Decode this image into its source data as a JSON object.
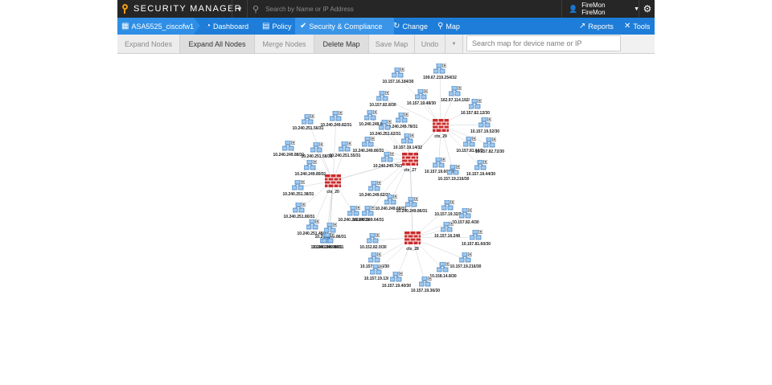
{
  "topbar": {
    "logo_text": "SECURITY MANAGER",
    "search_placeholder": "Search by Name or IP Address",
    "user_name": "FireMon FireMon",
    "icons": {
      "logo": "magnifier-logo-icon",
      "menu_caret": "caret-down-icon",
      "search": "search-icon",
      "user": "user-icon",
      "settings": "gear-icon"
    }
  },
  "nav": {
    "device_name": "ASA5525_ciscofw1",
    "items": [
      {
        "label": "Dashboard",
        "icon": "dashboard-icon"
      },
      {
        "label": "Policy",
        "icon": "document-icon"
      },
      {
        "label": "Security & Compliance",
        "icon": "check-shield-icon"
      },
      {
        "label": "Change",
        "icon": "refresh-icon"
      },
      {
        "label": "Map",
        "icon": "map-marker-icon"
      }
    ],
    "right": [
      {
        "label": "Reports",
        "icon": "line-chart-icon"
      },
      {
        "label": "Tools",
        "icon": "tools-icon"
      }
    ]
  },
  "toolbar": {
    "buttons": [
      {
        "label": "Expand Nodes",
        "enabled": false
      },
      {
        "label": "Expand All Nodes",
        "enabled": true
      },
      {
        "label": "Merge Nodes",
        "enabled": false
      },
      {
        "label": "Delete Map",
        "enabled": true
      },
      {
        "label": "Save Map",
        "enabled": false
      },
      {
        "label": "Undo",
        "enabled": false
      }
    ],
    "search_placeholder": "Search map for device name or IP"
  },
  "colors": {
    "topbar": "#262626",
    "nav": "#1d7dd8",
    "firewall": "#cc2b2b",
    "link": "#c9cfd6",
    "node": "#8fc1ea"
  },
  "map": {
    "firewalls": [
      {
        "id": "f20",
        "label": "ctx_20"
      },
      {
        "id": "f27",
        "label": "ctx_27"
      },
      {
        "id": "f29",
        "label": "ctx_29"
      },
      {
        "id": "f28",
        "label": "ctx_28"
      }
    ],
    "links": [
      [
        "f20",
        "f27"
      ],
      [
        "f27",
        "f29"
      ],
      [
        "f27",
        "f28"
      ]
    ],
    "networks": [
      {
        "label": "10.240.251.56/31",
        "fw": "f20"
      },
      {
        "label": "10.240.249.82/31",
        "fw": "f20"
      },
      {
        "label": "10.240.249.88/31",
        "fw": "f20"
      },
      {
        "label": "10.240.251.58/31",
        "fw": "f20"
      },
      {
        "label": "10.240.251.55/31",
        "fw": "f20"
      },
      {
        "label": "10.240.249.80/31",
        "fw": "f20"
      },
      {
        "label": "10.240.251.38/31",
        "fw": "f20"
      },
      {
        "label": "10.240.251.80/31",
        "fw": "f20"
      },
      {
        "label": "10.240.251.48/31",
        "fw": "f20"
      },
      {
        "label": "10.240.249.86/31",
        "fw": "f20"
      },
      {
        "label": "10.240.249.90/31",
        "fw": "f20"
      },
      {
        "label": "10.240.249.64/31",
        "fw": "f20"
      },
      {
        "label": "10.240.249.90/31",
        "fw": "f20"
      },
      {
        "label": "10.240.249.8",
        "fw": "f27"
      },
      {
        "label": "10.240.249.78/31",
        "fw": "f27"
      },
      {
        "label": "10.240.251.62/31",
        "fw": "f27"
      },
      {
        "label": "10.240.249.80/31",
        "fw": "f27"
      },
      {
        "label": "10.240.249.76/3",
        "fw": "f27"
      },
      {
        "label": "10.157.19.14/32",
        "fw": "f27"
      },
      {
        "label": "10.240.249.62/31",
        "fw": "f27"
      },
      {
        "label": "10.240.249.68/31",
        "fw": "f27"
      },
      {
        "label": "10.240.249.86/31",
        "fw": "f27"
      },
      {
        "label": "10.240.249.64/31",
        "fw": "f27"
      },
      {
        "label": "10.157.16.184/30",
        "fw": "f29"
      },
      {
        "label": "199.67.219.254/32",
        "fw": "f29"
      },
      {
        "label": "10.157.82.8/30",
        "fw": "f29"
      },
      {
        "label": "10.157.19.48/30",
        "fw": "f29"
      },
      {
        "label": "162.97.114.192/",
        "fw": "f29"
      },
      {
        "label": "10.157.82.12/30",
        "fw": "f29"
      },
      {
        "label": "10.157.19.52/30",
        "fw": "f29"
      },
      {
        "label": "10.157.81.64/2",
        "fw": "f29"
      },
      {
        "label": "10.157.82.72/30",
        "fw": "f29"
      },
      {
        "label": "10.157.19.60/30",
        "fw": "f29"
      },
      {
        "label": "10.157.19.216/30",
        "fw": "f29"
      },
      {
        "label": "10.157.19.44/30",
        "fw": "f29"
      },
      {
        "label": "10.157.19.32/3",
        "fw": "f28"
      },
      {
        "label": "10.157.82.4/30",
        "fw": "f28"
      },
      {
        "label": "10.157.16.248",
        "fw": "f28"
      },
      {
        "label": "10.157.81.60/30",
        "fw": "f28"
      },
      {
        "label": "10.157.19.216/30",
        "fw": "f28"
      },
      {
        "label": "10.152.82.0/30",
        "fw": "f28"
      },
      {
        "label": "10.157.19.56/30",
        "fw": "f28"
      },
      {
        "label": "10.157.19.13/",
        "fw": "f28"
      },
      {
        "label": "10.157.19.40/30",
        "fw": "f28"
      },
      {
        "label": "10.158.14.8/30",
        "fw": "f28"
      },
      {
        "label": "10.157.19.36/30",
        "fw": "f28"
      }
    ]
  }
}
